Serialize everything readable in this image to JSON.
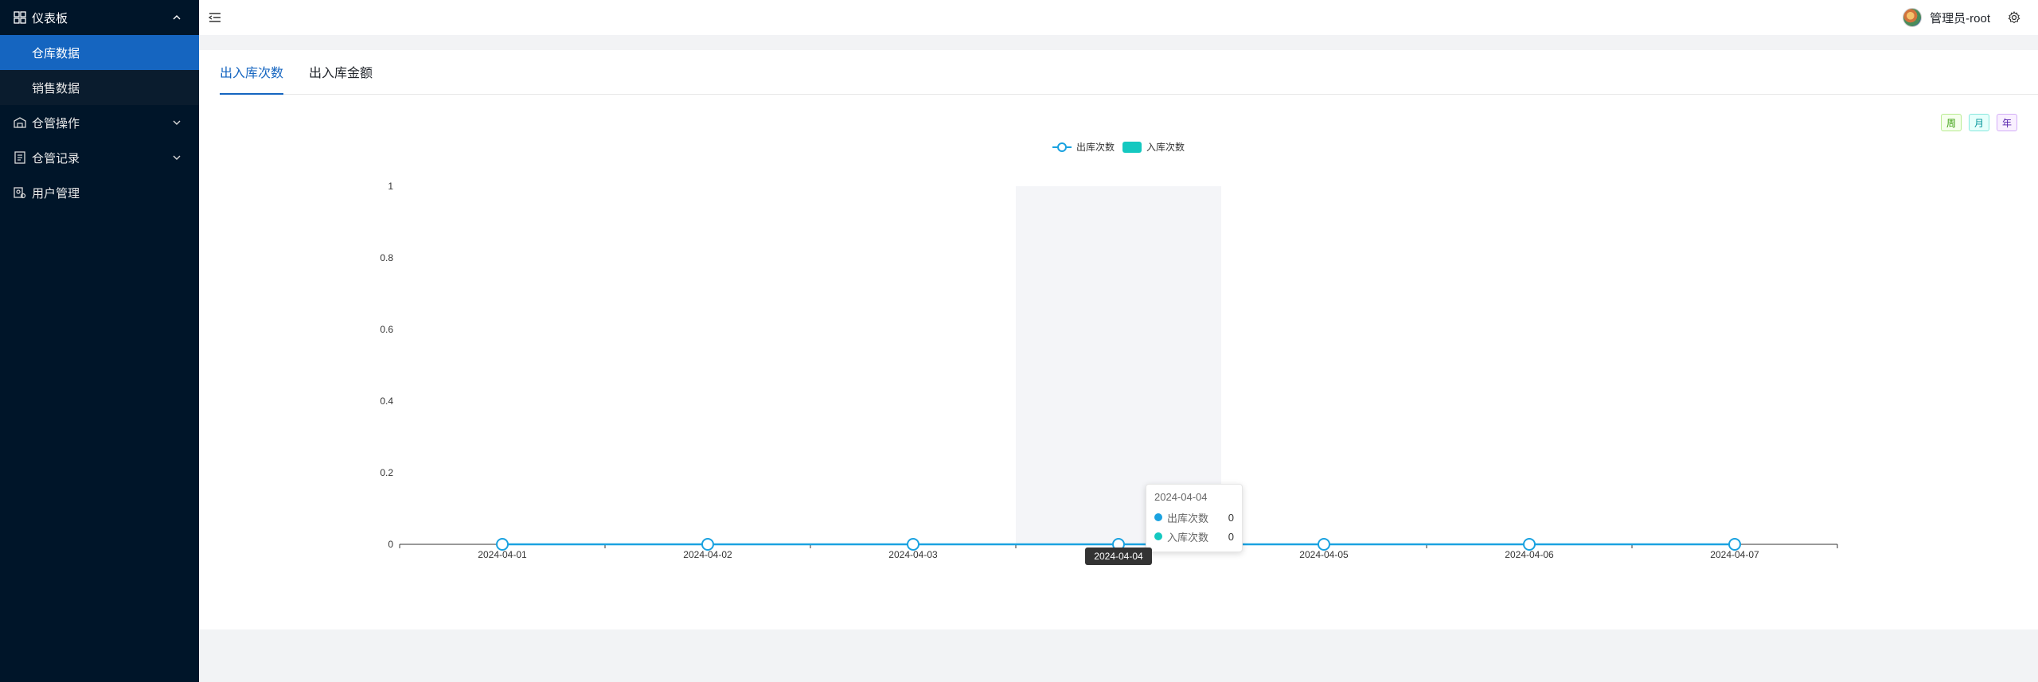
{
  "sidebar": {
    "dashboard_label": "仪表板",
    "dashboard_children": [
      "仓库数据",
      "销售数据"
    ],
    "items": [
      {
        "label": "仓管操作"
      },
      {
        "label": "仓管记录"
      },
      {
        "label": "用户管理"
      }
    ]
  },
  "header": {
    "user_name": "管理员-root"
  },
  "tabs": [
    "出入库次数",
    "出入库金额"
  ],
  "period_buttons": [
    "周",
    "月",
    "年"
  ],
  "colors": {
    "accent": "#1565c0",
    "sidebar_bg": "#001529",
    "line_series": "#1aa2e0",
    "bar_series": "#14c8c0"
  },
  "chart_data": {
    "type": "line",
    "legend": [
      "出库次数",
      "入库次数"
    ],
    "legend_position": "top-center",
    "categories": [
      "2024-04-01",
      "2024-04-02",
      "2024-04-03",
      "2024-04-04",
      "2024-04-05",
      "2024-04-06",
      "2024-04-07"
    ],
    "series": [
      {
        "name": "出库次数",
        "type": "line",
        "values": [
          0,
          0,
          0,
          0,
          0,
          0,
          0
        ]
      },
      {
        "name": "入库次数",
        "type": "bar",
        "values": [
          0,
          0,
          0,
          0,
          0,
          0,
          0
        ]
      }
    ],
    "yticks": [
      "0",
      "0.2",
      "0.4",
      "0.6",
      "0.8",
      "1"
    ],
    "ylim": [
      0,
      1
    ],
    "highlighted_category": "2024-04-04"
  },
  "tooltip": {
    "title": "2024-04-04",
    "rows": [
      {
        "label": "出库次数",
        "value": "0"
      },
      {
        "label": "入库次数",
        "value": "0"
      }
    ]
  }
}
